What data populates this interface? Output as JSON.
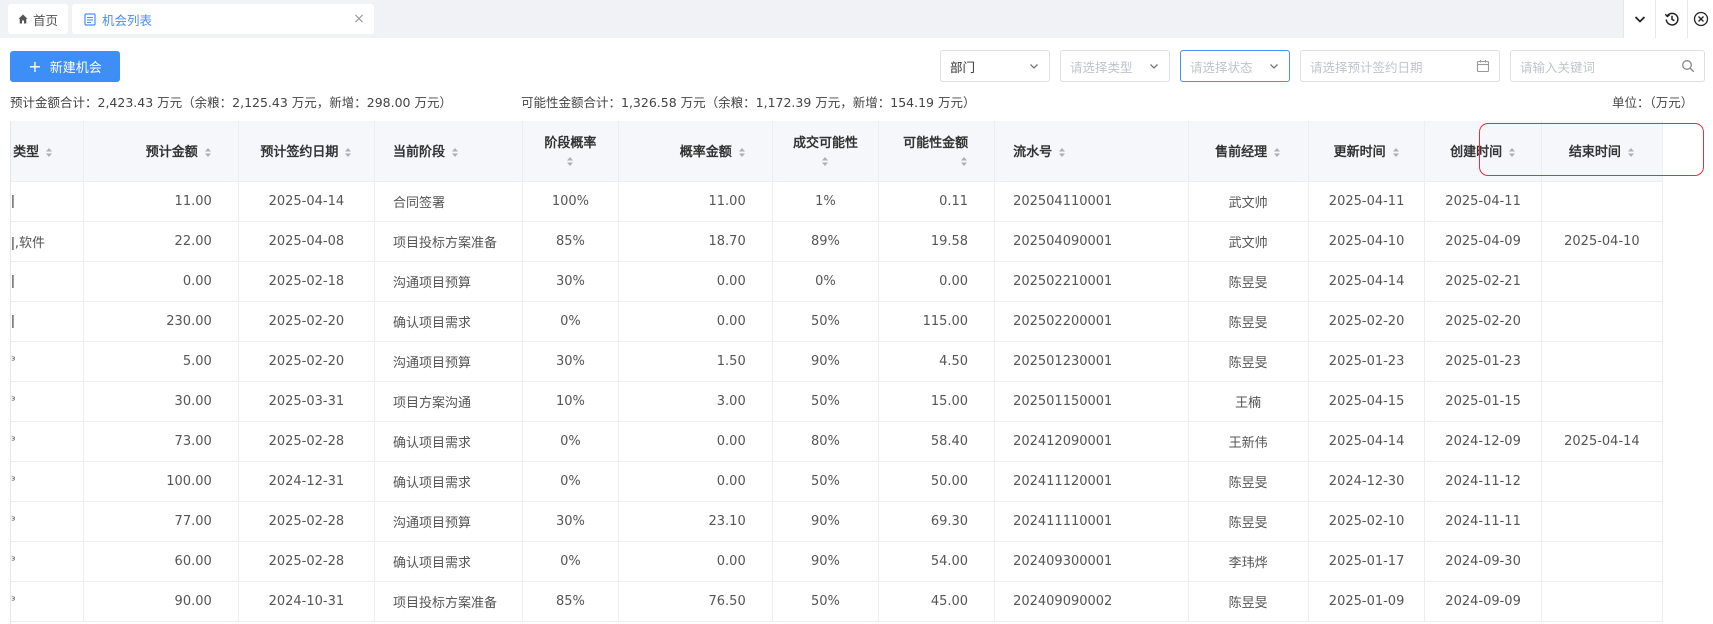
{
  "tabs": {
    "home_label": "首页",
    "active_label": "机会列表"
  },
  "toolbar": {
    "new_button_label": "新建机会",
    "dept_value": "部门",
    "type_placeholder": "请选择类型",
    "status_placeholder": "请选择状态",
    "date_placeholder": "请选择预计签约日期",
    "keyword_placeholder": "请输入关键词"
  },
  "summary": {
    "expected": "预计金额合计：2,423.43 万元（余粮：2,125.43 万元，新增：298.00 万元）",
    "possible": "可能性金额合计：1,326.58 万元（余粮：1,172.39 万元，新增：154.19 万元）",
    "unit": "单位：（万元）"
  },
  "table": {
    "headers": [
      "类型",
      "预计金额",
      "预计签约日期",
      "当前阶段",
      "阶段概率",
      "概率金额",
      "成交可能性",
      "可能性金额",
      "流水号",
      "售前经理",
      "更新时间",
      "创建时间",
      "结束时间"
    ],
    "rows": [
      [
        "ǀ",
        "11.00",
        "2025-04-14",
        "合同签署",
        "100%",
        "11.00",
        "1%",
        "0.11",
        "202504110001",
        "武文帅",
        "2025-04-11",
        "2025-04-11",
        ""
      ],
      [
        "ǀ,软件",
        "22.00",
        "2025-04-08",
        "项目投标方案准备",
        "85%",
        "18.70",
        "89%",
        "19.58",
        "202504090001",
        "武文帅",
        "2025-04-10",
        "2025-04-09",
        "2025-04-10"
      ],
      [
        "ǀ",
        "0.00",
        "2025-02-18",
        "沟通项目预算",
        "30%",
        "0.00",
        "0%",
        "0.00",
        "202502210001",
        "陈昱旻",
        "2025-04-14",
        "2025-02-21",
        ""
      ],
      [
        "ǀ",
        "230.00",
        "2025-02-20",
        "确认项目需求",
        "0%",
        "0.00",
        "50%",
        "115.00",
        "202502200001",
        "陈昱旻",
        "2025-02-20",
        "2025-02-20",
        ""
      ],
      [
        "ᵌ",
        "5.00",
        "2025-02-20",
        "沟通项目预算",
        "30%",
        "1.50",
        "90%",
        "4.50",
        "202501230001",
        "陈昱旻",
        "2025-01-23",
        "2025-01-23",
        ""
      ],
      [
        "ᵌ",
        "30.00",
        "2025-03-31",
        "项目方案沟通",
        "10%",
        "3.00",
        "50%",
        "15.00",
        "202501150001",
        "王楠",
        "2025-04-15",
        "2025-01-15",
        ""
      ],
      [
        "ᵌ",
        "73.00",
        "2025-02-28",
        "确认项目需求",
        "0%",
        "0.00",
        "80%",
        "58.40",
        "202412090001",
        "王新伟",
        "2025-04-14",
        "2024-12-09",
        "2025-04-14"
      ],
      [
        "ᵌ",
        "100.00",
        "2024-12-31",
        "确认项目需求",
        "0%",
        "0.00",
        "50%",
        "50.00",
        "202411120001",
        "陈昱旻",
        "2024-12-30",
        "2024-11-12",
        ""
      ],
      [
        "ᵌ",
        "77.00",
        "2025-02-28",
        "沟通项目预算",
        "30%",
        "23.10",
        "90%",
        "69.30",
        "202411110001",
        "陈昱旻",
        "2025-02-10",
        "2024-11-11",
        ""
      ],
      [
        "ᵌ",
        "60.00",
        "2025-02-28",
        "确认项目需求",
        "0%",
        "0.00",
        "90%",
        "54.00",
        "202409300001",
        "李玮烨",
        "2025-01-17",
        "2024-09-30",
        ""
      ],
      [
        "ᵌ",
        "90.00",
        "2024-10-31",
        "项目投标方案准备",
        "85%",
        "76.50",
        "50%",
        "45.00",
        "202409090002",
        "陈昱旻",
        "2025-01-09",
        "2024-09-09",
        ""
      ]
    ]
  },
  "colors": {
    "accent": "#3d8ef6",
    "highlight": "#e8303a"
  }
}
